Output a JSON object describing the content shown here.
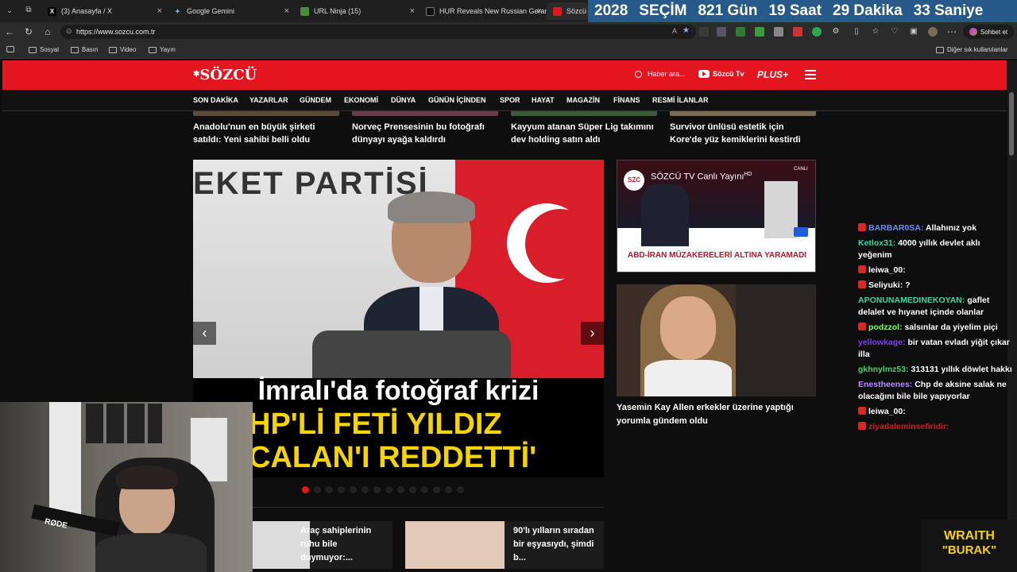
{
  "browser": {
    "tabs": [
      {
        "label": "(3) Anasayfa / X",
        "icon": "x-logo-icon"
      },
      {
        "label": "Google Gemini",
        "icon": "gemini-icon"
      },
      {
        "label": "URL Ninja (15)",
        "icon": "ninja-icon"
      },
      {
        "label": "HUR Reveals New Russian Geran-...",
        "icon": "news-icon"
      },
      {
        "label": "Sözcü Ga",
        "icon": "sozcu-icon"
      }
    ],
    "url": "https://www.sozcu.com.tr",
    "chat_button": "Sohbet et",
    "bookmarks": [
      "Sosyal",
      "Basın",
      "Video",
      "Yayın"
    ],
    "other_bookmarks": "Diğer sık kullanılanlar"
  },
  "countdown": {
    "year": "2028",
    "label": "SEÇİM",
    "days": "821 Gün",
    "hours": "19 Saat",
    "minutes": "29 Dakika",
    "seconds": "33 Saniye"
  },
  "site": {
    "logo": "SÖZCÜ",
    "search_placeholder": "Haber ara...",
    "tv_label": "Sözcü Tv",
    "plus_label": "PLUS+",
    "nav": [
      "SON DAKİKA",
      "YAZARLAR",
      "GÜNDEM",
      "EKONOMİ",
      "DÜNYA",
      "GÜNÜN İÇİNDEN",
      "SPOR",
      "HAYAT",
      "MAGAZİN",
      "FİNANS",
      "RESMİ İLANLAR"
    ]
  },
  "top_headlines": [
    "Anadolu'nun en büyük şirketi satıldı: Yeni sahibi belli oldu",
    "Norveç Prensesinin bu fotoğrafı dünyayı ayağa kaldırdı",
    "Kayyum atanan Süper Lig takımını dev holding satın aldı",
    "Survivor ünlüsü estetik için Kore'de yüz kemiklerini kestirdi"
  ],
  "hero": {
    "backdrop_text": "EKET PARTİSİ",
    "title": "İmralı'da fotoğraf krizi",
    "subtitle_line1": "HP'Lİ FETİ YILDIZ",
    "subtitle_line2": "CALAN'I REDDETTİ'",
    "prev": "‹",
    "next": "›",
    "dot_count": 14
  },
  "tv_card": {
    "badge": "SZC",
    "title": "SÖZCÜ TV Canlı Yayını",
    "hd": "HD",
    "live": "CANLI",
    "banner": "ABD-İRAN MÜZAKERELERİ ALTINA YARAMADI"
  },
  "side_story": "Yasemin Kay Allen erkekler üzerine yaptığı yorumla gündem oldu",
  "bottom_cards": [
    "Araç sahiplerinin ruhu bile duymuyor:...",
    "90'lı yılların sıradan bir eşyasıydı, şimdi b..."
  ],
  "chat": [
    {
      "user": "BARBAR0SA",
      "text": "Allahınız yok",
      "color": "#6e8cff",
      "badge": true
    },
    {
      "user": "Ketlox31",
      "text": "4000 yıllık devlet aklı yeğenim",
      "color": "#3cd6a0",
      "badge": false
    },
    {
      "user": "leiwa_00",
      "text": "",
      "color": "#ffffff",
      "badge": true
    },
    {
      "user": "Seliyuki",
      "text": "?",
      "color": "#ffffff",
      "badge": true
    },
    {
      "user": "APONUNAMEDINEKOYAN",
      "text": "gaflet delalet ve hıyanet içinde olanlar",
      "color": "#3cd6a0",
      "badge": false
    },
    {
      "user": "podzzol",
      "text": "salsınlar da yiyelim piçi",
      "color": "#7cff5a",
      "badge": true
    },
    {
      "user": "yellowkage",
      "text": "bir vatan evladı yiğit çıkar illa",
      "color": "#7d3cff",
      "badge": false
    },
    {
      "user": "gkhnylmz53",
      "text": "313131 yıllık döwlet hakkı",
      "color": "#3cd66a",
      "badge": false
    },
    {
      "user": "Enestheenes",
      "text": "Chp de aksine salak ne olacağını bile bile yapıyorlar",
      "color": "#b48cff",
      "badge": false
    },
    {
      "user": "leiwa_00",
      "text": "",
      "color": "#ffffff",
      "badge": true
    },
    {
      "user": "ziyadaleminsefiridir",
      "text": "",
      "color": "#e3151f",
      "badge": true
    }
  ],
  "overlay": {
    "brand_top": "WRAITH",
    "brand_bottom": "\"BURAK\"",
    "mic_brand": "RØDE"
  },
  "colors": {
    "brand_red": "#e3151f",
    "countdown_bg": "#275a8a",
    "hero_yellow": "#f5d400"
  }
}
